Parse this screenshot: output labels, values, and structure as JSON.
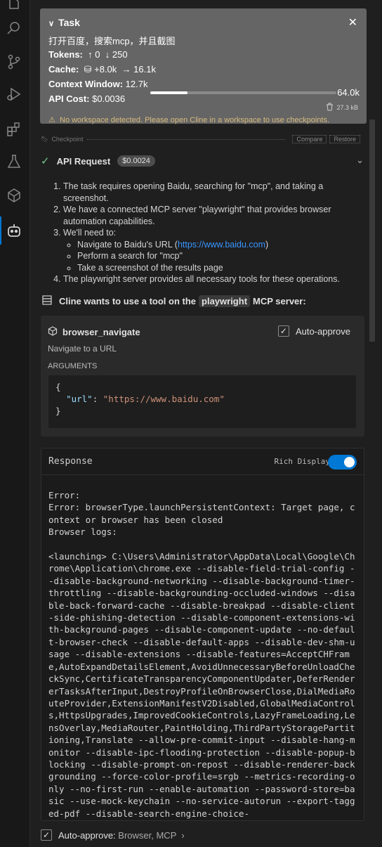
{
  "task": {
    "title": "Task",
    "text": "打开百度，搜索mcp，并且截图",
    "tokens_label": "Tokens:",
    "tokens_in": "0",
    "tokens_out": "250",
    "cache_label": "Cache:",
    "cache_write": "+8.0k",
    "cache_read": "16.1k",
    "context_label": "Context Window:",
    "context_used": "12.7k",
    "context_max": "64.0k",
    "context_fraction": 0.2,
    "api_cost_label": "API Cost:",
    "api_cost": "$0.0036",
    "size": "27.3 kB",
    "warning": "No workspace detected. Please open Cline in a workspace to use checkpoints."
  },
  "checkpoint": {
    "label": "Checkpoint",
    "compare": "Compare",
    "restore": "Restore"
  },
  "api_request": {
    "title": "API Request",
    "cost": "$0.0024"
  },
  "steps": {
    "s1": "The task requires opening Baidu, searching for \"mcp\", and taking a screenshot.",
    "s2": "We have a connected MCP server \"playwright\" that provides browser automation capabilities.",
    "s3": "We'll need to:",
    "s3a_pre": "Navigate to Baidu's URL (",
    "s3a_link": "https://www.baidu.com",
    "s3a_post": ")",
    "s3b": "Perform a search for \"mcp\"",
    "s3c": "Take a screenshot of the results page",
    "s4": "The playwright server provides all necessary tools for these operations."
  },
  "tool": {
    "intro_pre": "Cline wants to use a tool on the",
    "server": "playwright",
    "intro_post": "MCP server:",
    "name": "browser_navigate",
    "auto_approve": "Auto-approve",
    "description": "Navigate to a URL",
    "args_label": "ARGUMENTS",
    "arg_key": "\"url\"",
    "arg_value": "\"https://www.baidu.com\""
  },
  "response": {
    "title": "Response",
    "rich_display": "Rich Display",
    "body": "Error:\nError: browserType.launchPersistentContext: Target page, context or browser has been closed\nBrowser logs:\n\n<launching> C:\\Users\\Administrator\\AppData\\Local\\Google\\Chrome\\Application\\chrome.exe --disable-field-trial-config --disable-background-networking --disable-background-timer-throttling --disable-backgrounding-occluded-windows --disable-back-forward-cache --disable-breakpad --disable-client-side-phishing-detection --disable-component-extensions-with-background-pages --disable-component-update --no-default-browser-check --disable-default-apps --disable-dev-shm-usage --disable-extensions --disable-features=AcceptCHFrame,AutoExpandDetailsElement,AvoidUnnecessaryBeforeUnloadCheckSync,CertificateTransparencyComponentUpdater,DeferRendererTasksAfterInput,DestroyProfileOnBrowserClose,DialMediaRouteProvider,ExtensionManifestV2Disabled,GlobalMediaControls,HttpsUpgrades,ImprovedCookieControls,LazyFrameLoading,LensOverlay,MediaRouter,PaintHolding,ThirdPartyStoragePartitioning,Translate --allow-pre-commit-input --disable-hang-monitor --disable-ipc-flooding-protection --disable-popup-blocking --disable-prompt-on-repost --disable-renderer-backgrounding --force-color-profile=srgb --metrics-recording-only --no-first-run --enable-automation --password-store=basic --use-mock-keychain --no-service-autorun --export-tagged-pdf --disable-search-engine-choice-"
  },
  "bottom": {
    "auto_approve_label": "Auto-approve:",
    "auto_approve_value": "Browser, MCP"
  },
  "colors": {
    "accent": "#0078d4",
    "success": "#73c991",
    "warning": "#d7ba7d",
    "link": "#3794ff"
  }
}
